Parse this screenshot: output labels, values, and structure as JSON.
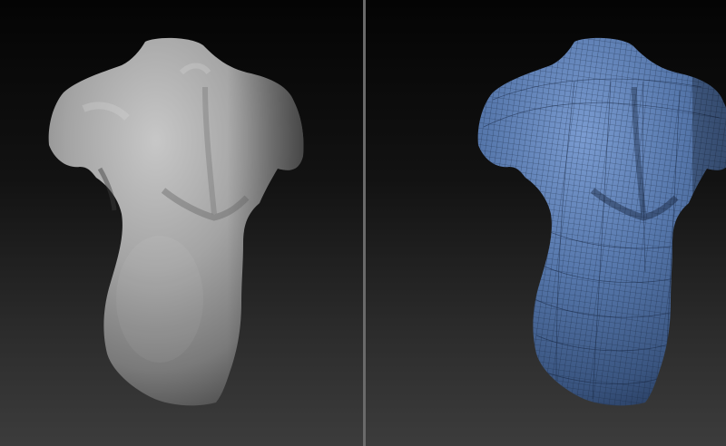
{
  "viewports": [
    {
      "name": "sculpt-solid-view",
      "material_color": "#a9a9a9",
      "shading_color": "#555555",
      "wireframe": false
    },
    {
      "name": "sculpt-wireframe-view",
      "material_color": "#5b7fb3",
      "shading_color": "#243a5c",
      "wireframe": true,
      "wire_color": "#1a2a44"
    }
  ]
}
